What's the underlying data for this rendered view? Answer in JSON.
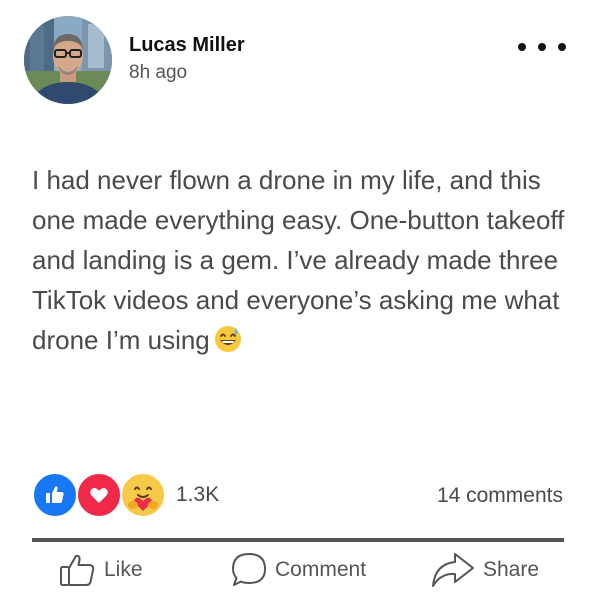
{
  "post": {
    "author": "Lucas Miller",
    "time": "8h ago",
    "text": "I had never flown a drone in my life, and this one made everything easy. One-button takeoff and landing is a gem. I’ve already made three TikTok videos and everyone’s asking me what drone I’m using",
    "emoji": "sweat-smile-emoji"
  },
  "reactions": {
    "icons": [
      "like-icon",
      "love-icon",
      "care-icon"
    ],
    "count": "1.3K"
  },
  "comments": "14 comments",
  "actions": {
    "like": "Like",
    "comment": "Comment",
    "share": "Share"
  },
  "colors": {
    "like": "#1877f2",
    "love": "#f0284a",
    "care": "#f7c948",
    "text": "#4a4a4a"
  }
}
